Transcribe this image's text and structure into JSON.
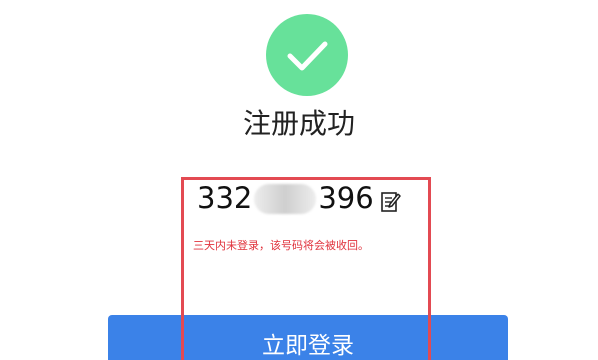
{
  "status": {
    "icon": "check-circle-icon",
    "title": "注册成功",
    "accent_color": "#67e19a"
  },
  "account": {
    "prefix": "332",
    "suffix": "396",
    "copy_icon": "edit-copy-icon"
  },
  "notice": {
    "text": "三天内未登录，该号码将会被收回。",
    "color": "#e0323c"
  },
  "login_button": {
    "label": "立即登录",
    "color": "#3b82e8"
  },
  "highlight_color": "#e34a52"
}
